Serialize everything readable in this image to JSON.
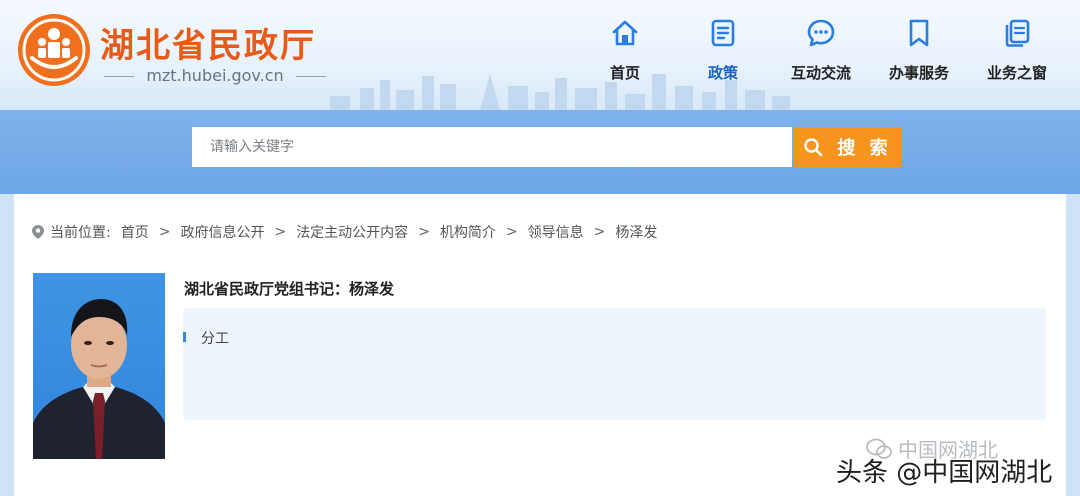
{
  "header": {
    "site_name": "湖北省民政厅",
    "site_domain": "mzt.hubei.gov.cn",
    "brand_color": "#e85a17"
  },
  "nav": {
    "items": [
      {
        "label": "首页",
        "icon": "home-icon",
        "active": false
      },
      {
        "label": "政策",
        "icon": "document-icon",
        "active": true
      },
      {
        "label": "互动交流",
        "icon": "chat-icon",
        "active": false
      },
      {
        "label": "办事服务",
        "icon": "bookmark-icon",
        "active": false
      },
      {
        "label": "业务之窗",
        "icon": "files-icon",
        "active": false
      }
    ],
    "active_color": "#1a63c4",
    "icon_color": "#2a7de1"
  },
  "search": {
    "placeholder": "请输入关键字",
    "button_label": "搜 索",
    "button_color": "#f7941d"
  },
  "breadcrumb": {
    "label": "当前位置:",
    "items": [
      "首页",
      "政府信息公开",
      "法定主动公开内容",
      "机构简介",
      "领导信息",
      "杨泽发"
    ],
    "separator": ">"
  },
  "profile": {
    "title": "湖北省民政厅党组书记：杨泽发",
    "duty_label": "分工"
  },
  "watermark": {
    "source": "中国网湖北",
    "credit": "头条 @中国网湖北"
  }
}
